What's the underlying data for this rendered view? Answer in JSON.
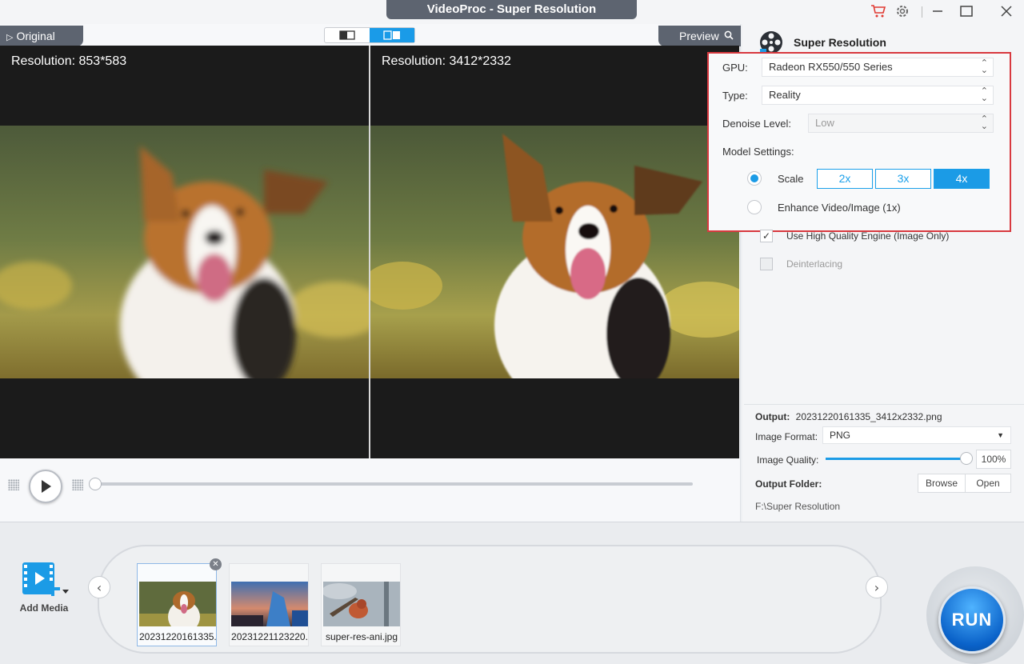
{
  "window": {
    "title": "VideoProc  - Super Resolution"
  },
  "preview": {
    "tab_original": "Original",
    "tab_preview": "Preview",
    "left_resolution": "Resolution: 853*583",
    "right_resolution": "Resolution: 3412*2332"
  },
  "panel": {
    "title": "Super Resolution",
    "gpu_label": "GPU:",
    "gpu_value": "Radeon RX550/550 Series",
    "type_label": "Type:",
    "type_value": "Reality",
    "denoise_label": "Denoise Level:",
    "denoise_value": "Low",
    "model_settings_label": "Model Settings:",
    "scale_label": "Scale",
    "scale_options": [
      "2x",
      "3x",
      "4x"
    ],
    "scale_selected": "4x",
    "enhance_label": "Enhance Video/Image (1x)",
    "hq_engine_label": "Use High Quality Engine (Image Only)",
    "deinterlacing_label": "Deinterlacing"
  },
  "output": {
    "output_label": "Output:",
    "output_filename": "20231220161335_3412x2332.png",
    "format_label": "Image Format:",
    "format_value": "PNG",
    "quality_label": "Image Quality:",
    "quality_value": "100%",
    "folder_label": "Output Folder:",
    "browse_label": "Browse",
    "open_label": "Open",
    "folder_path": "F:\\Super Resolution"
  },
  "media": {
    "add_media_label": "Add Media",
    "items": [
      {
        "name": "20231220161335."
      },
      {
        "name": "20231221123220."
      },
      {
        "name": "super-res-ani.jpg"
      }
    ]
  },
  "run_label": "RUN",
  "colors": {
    "accent": "#1b9be6",
    "highlight_border": "#d8393f",
    "dark_header": "#5d6470"
  }
}
